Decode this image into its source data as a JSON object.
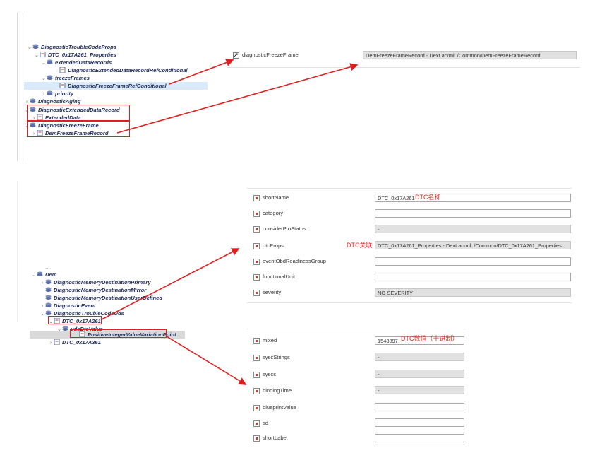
{
  "top_tree": [
    {
      "label": "DiagnosticTroubleCodeProps",
      "arrow": "⌄",
      "icon": "stack"
    },
    {
      "label": "DTC_0x17A261_Properties",
      "arrow": "⌄",
      "icon": "doc"
    },
    {
      "label": "extendedDataRecords",
      "arrow": "⌄",
      "icon": "stack"
    },
    {
      "label": "DiagnosticExtendedDataRecordRefConditional",
      "arrow": "",
      "icon": "doc"
    },
    {
      "label": "freezeFrames",
      "arrow": "⌄",
      "icon": "stack"
    },
    {
      "label": "DiagnosticFreezeFrameRefConditional",
      "arrow": "",
      "icon": "doc"
    },
    {
      "label": "priority",
      "arrow": "›",
      "icon": "stack"
    },
    {
      "label": "DiagnosticAging",
      "arrow": "›",
      "icon": "stack"
    },
    {
      "label": "DiagnosticExtendedDataRecord",
      "arrow": "⌄",
      "icon": "stack"
    },
    {
      "label": "ExtendedData",
      "arrow": "›",
      "icon": "doc"
    },
    {
      "label": "DiagnosticFreezeFrame",
      "arrow": "⌄",
      "icon": "stack"
    },
    {
      "label": "DemFreezeFrameRecord",
      "arrow": "›",
      "icon": "doc"
    }
  ],
  "freeze_prop": {
    "label": "diagnosticFreezeFrame",
    "value": "DemFreezeFrameRecord - Dext.arxml: /Common/DemFreezeFrameRecord"
  },
  "bottom_tree": [
    {
      "label": "Dem",
      "arrow": "⌄",
      "icon": "stack"
    },
    {
      "label": "DiagnosticMemoryDestinationPrimary",
      "arrow": "›",
      "icon": "stack"
    },
    {
      "label": "DiagnosticMemoryDestinationMirror",
      "arrow": "",
      "icon": "stack"
    },
    {
      "label": "DiagnosticMemoryDestinationUserDefined",
      "arrow": "",
      "icon": "stack"
    },
    {
      "label": "DiagnosticEvent",
      "arrow": "›",
      "icon": "stack"
    },
    {
      "label": "DiagnosticTroubleCodeUds",
      "arrow": "⌄",
      "icon": "stack"
    },
    {
      "label": "DTC_0x17A261",
      "arrow": "⌄",
      "icon": "doc"
    },
    {
      "label": "udsDtcValue",
      "arrow": "⌄",
      "icon": "stack"
    },
    {
      "label": "PositiveIntegerValueVariationPoint",
      "arrow": "",
      "icon": "doc"
    },
    {
      "label": "DTC_0x17A361",
      "arrow": "›",
      "icon": "doc"
    }
  ],
  "dtc_props": [
    {
      "label": "shortName",
      "value": "DTC_0x17A261"
    },
    {
      "label": "category",
      "value": ""
    },
    {
      "label": "considerPtoStatus",
      "value": "-"
    },
    {
      "label": "dtcProps",
      "value": "DTC_0x17A261_Properties - Dext.arxml: /Common/DTC_0x17A261_Properties"
    },
    {
      "label": "eventObdReadinessGroup",
      "value": ""
    },
    {
      "label": "functionalUnit",
      "value": ""
    },
    {
      "label": "severity",
      "value": "NO-SEVERITY"
    }
  ],
  "value_props": [
    {
      "label": "mixed",
      "value": "1548897"
    },
    {
      "label": "syscStrings",
      "value": "-"
    },
    {
      "label": "syscs",
      "value": "-"
    },
    {
      "label": "bindingTime",
      "value": "-"
    },
    {
      "label": "blueprintValue",
      "value": ""
    },
    {
      "label": "sd",
      "value": ""
    },
    {
      "label": "shortLabel",
      "value": ""
    }
  ],
  "notes": {
    "dtc_name": "DTC名称",
    "dtc_link": "DTC关联",
    "dtc_value": "DTC数值（十进制）"
  },
  "colors": {
    "annotation": "#e8261f",
    "tree_text": "#1f2a5c",
    "selection": "#dbeaf8"
  }
}
